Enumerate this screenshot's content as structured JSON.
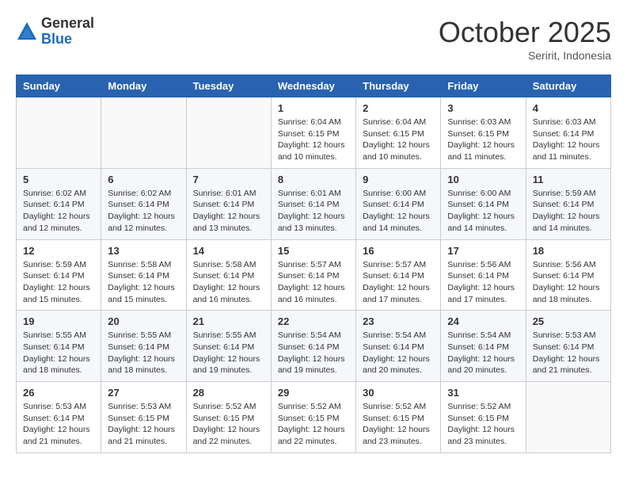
{
  "logo": {
    "general": "General",
    "blue": "Blue"
  },
  "header": {
    "month": "October 2025",
    "location": "Seririt, Indonesia"
  },
  "weekdays": [
    "Sunday",
    "Monday",
    "Tuesday",
    "Wednesday",
    "Thursday",
    "Friday",
    "Saturday"
  ],
  "weeks": [
    [
      {
        "day": "",
        "sunrise": "",
        "sunset": "",
        "daylight": ""
      },
      {
        "day": "",
        "sunrise": "",
        "sunset": "",
        "daylight": ""
      },
      {
        "day": "",
        "sunrise": "",
        "sunset": "",
        "daylight": ""
      },
      {
        "day": "1",
        "sunrise": "Sunrise: 6:04 AM",
        "sunset": "Sunset: 6:15 PM",
        "daylight": "Daylight: 12 hours and 10 minutes."
      },
      {
        "day": "2",
        "sunrise": "Sunrise: 6:04 AM",
        "sunset": "Sunset: 6:15 PM",
        "daylight": "Daylight: 12 hours and 10 minutes."
      },
      {
        "day": "3",
        "sunrise": "Sunrise: 6:03 AM",
        "sunset": "Sunset: 6:15 PM",
        "daylight": "Daylight: 12 hours and 11 minutes."
      },
      {
        "day": "4",
        "sunrise": "Sunrise: 6:03 AM",
        "sunset": "Sunset: 6:14 PM",
        "daylight": "Daylight: 12 hours and 11 minutes."
      }
    ],
    [
      {
        "day": "5",
        "sunrise": "Sunrise: 6:02 AM",
        "sunset": "Sunset: 6:14 PM",
        "daylight": "Daylight: 12 hours and 12 minutes."
      },
      {
        "day": "6",
        "sunrise": "Sunrise: 6:02 AM",
        "sunset": "Sunset: 6:14 PM",
        "daylight": "Daylight: 12 hours and 12 minutes."
      },
      {
        "day": "7",
        "sunrise": "Sunrise: 6:01 AM",
        "sunset": "Sunset: 6:14 PM",
        "daylight": "Daylight: 12 hours and 13 minutes."
      },
      {
        "day": "8",
        "sunrise": "Sunrise: 6:01 AM",
        "sunset": "Sunset: 6:14 PM",
        "daylight": "Daylight: 12 hours and 13 minutes."
      },
      {
        "day": "9",
        "sunrise": "Sunrise: 6:00 AM",
        "sunset": "Sunset: 6:14 PM",
        "daylight": "Daylight: 12 hours and 14 minutes."
      },
      {
        "day": "10",
        "sunrise": "Sunrise: 6:00 AM",
        "sunset": "Sunset: 6:14 PM",
        "daylight": "Daylight: 12 hours and 14 minutes."
      },
      {
        "day": "11",
        "sunrise": "Sunrise: 5:59 AM",
        "sunset": "Sunset: 6:14 PM",
        "daylight": "Daylight: 12 hours and 14 minutes."
      }
    ],
    [
      {
        "day": "12",
        "sunrise": "Sunrise: 5:59 AM",
        "sunset": "Sunset: 6:14 PM",
        "daylight": "Daylight: 12 hours and 15 minutes."
      },
      {
        "day": "13",
        "sunrise": "Sunrise: 5:58 AM",
        "sunset": "Sunset: 6:14 PM",
        "daylight": "Daylight: 12 hours and 15 minutes."
      },
      {
        "day": "14",
        "sunrise": "Sunrise: 5:58 AM",
        "sunset": "Sunset: 6:14 PM",
        "daylight": "Daylight: 12 hours and 16 minutes."
      },
      {
        "day": "15",
        "sunrise": "Sunrise: 5:57 AM",
        "sunset": "Sunset: 6:14 PM",
        "daylight": "Daylight: 12 hours and 16 minutes."
      },
      {
        "day": "16",
        "sunrise": "Sunrise: 5:57 AM",
        "sunset": "Sunset: 6:14 PM",
        "daylight": "Daylight: 12 hours and 17 minutes."
      },
      {
        "day": "17",
        "sunrise": "Sunrise: 5:56 AM",
        "sunset": "Sunset: 6:14 PM",
        "daylight": "Daylight: 12 hours and 17 minutes."
      },
      {
        "day": "18",
        "sunrise": "Sunrise: 5:56 AM",
        "sunset": "Sunset: 6:14 PM",
        "daylight": "Daylight: 12 hours and 18 minutes."
      }
    ],
    [
      {
        "day": "19",
        "sunrise": "Sunrise: 5:55 AM",
        "sunset": "Sunset: 6:14 PM",
        "daylight": "Daylight: 12 hours and 18 minutes."
      },
      {
        "day": "20",
        "sunrise": "Sunrise: 5:55 AM",
        "sunset": "Sunset: 6:14 PM",
        "daylight": "Daylight: 12 hours and 18 minutes."
      },
      {
        "day": "21",
        "sunrise": "Sunrise: 5:55 AM",
        "sunset": "Sunset: 6:14 PM",
        "daylight": "Daylight: 12 hours and 19 minutes."
      },
      {
        "day": "22",
        "sunrise": "Sunrise: 5:54 AM",
        "sunset": "Sunset: 6:14 PM",
        "daylight": "Daylight: 12 hours and 19 minutes."
      },
      {
        "day": "23",
        "sunrise": "Sunrise: 5:54 AM",
        "sunset": "Sunset: 6:14 PM",
        "daylight": "Daylight: 12 hours and 20 minutes."
      },
      {
        "day": "24",
        "sunrise": "Sunrise: 5:54 AM",
        "sunset": "Sunset: 6:14 PM",
        "daylight": "Daylight: 12 hours and 20 minutes."
      },
      {
        "day": "25",
        "sunrise": "Sunrise: 5:53 AM",
        "sunset": "Sunset: 6:14 PM",
        "daylight": "Daylight: 12 hours and 21 minutes."
      }
    ],
    [
      {
        "day": "26",
        "sunrise": "Sunrise: 5:53 AM",
        "sunset": "Sunset: 6:14 PM",
        "daylight": "Daylight: 12 hours and 21 minutes."
      },
      {
        "day": "27",
        "sunrise": "Sunrise: 5:53 AM",
        "sunset": "Sunset: 6:15 PM",
        "daylight": "Daylight: 12 hours and 21 minutes."
      },
      {
        "day": "28",
        "sunrise": "Sunrise: 5:52 AM",
        "sunset": "Sunset: 6:15 PM",
        "daylight": "Daylight: 12 hours and 22 minutes."
      },
      {
        "day": "29",
        "sunrise": "Sunrise: 5:52 AM",
        "sunset": "Sunset: 6:15 PM",
        "daylight": "Daylight: 12 hours and 22 minutes."
      },
      {
        "day": "30",
        "sunrise": "Sunrise: 5:52 AM",
        "sunset": "Sunset: 6:15 PM",
        "daylight": "Daylight: 12 hours and 23 minutes."
      },
      {
        "day": "31",
        "sunrise": "Sunrise: 5:52 AM",
        "sunset": "Sunset: 6:15 PM",
        "daylight": "Daylight: 12 hours and 23 minutes."
      },
      {
        "day": "",
        "sunrise": "",
        "sunset": "",
        "daylight": ""
      }
    ]
  ]
}
